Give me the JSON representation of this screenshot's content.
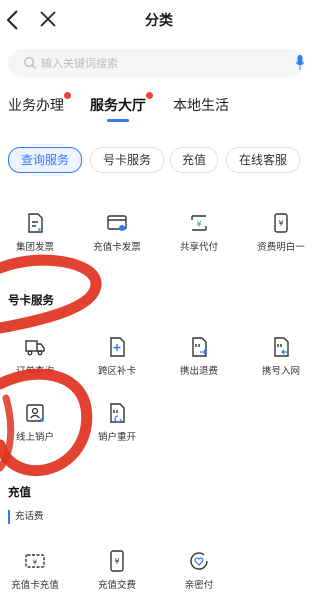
{
  "header": {
    "title": "分类",
    "back_icon": "back-arrow-icon",
    "close_icon": "close-icon"
  },
  "search": {
    "placeholder": "输入关键词搜索"
  },
  "tabs": [
    {
      "label": "业务办理",
      "badge": true,
      "active": false
    },
    {
      "label": "服务大厅",
      "badge": true,
      "active": true
    },
    {
      "label": "本地生活",
      "badge": false,
      "active": false
    }
  ],
  "chips": [
    {
      "label": "查询服务",
      "active": true
    },
    {
      "label": "号卡服务",
      "active": false
    },
    {
      "label": "充值",
      "active": false
    },
    {
      "label": "在线客服",
      "active": false
    }
  ],
  "query_items": [
    {
      "label": "集团发票",
      "icon": "invoice-icon"
    },
    {
      "label": "充值卡发票",
      "icon": "card-invoice-icon"
    },
    {
      "label": "共享代付",
      "icon": "shared-payment-icon"
    },
    {
      "label": "资费明白一",
      "icon": "tariff-icon"
    }
  ],
  "card_section": {
    "title": "号卡服务",
    "items": [
      {
        "label": "订单查询",
        "icon": "truck-icon"
      },
      {
        "label": "跨区补卡",
        "icon": "add-card-icon"
      },
      {
        "label": "携出退费",
        "icon": "port-out-icon"
      },
      {
        "label": "携号入网",
        "icon": "port-in-icon"
      },
      {
        "label": "线上销户",
        "icon": "id-card-icon"
      },
      {
        "label": "销户重开",
        "icon": "reopen-icon"
      }
    ]
  },
  "recharge_section": {
    "title": "充值",
    "subtitle": "充话费",
    "items": [
      {
        "label": "充值卡充值",
        "icon": "recharge-card-icon"
      },
      {
        "label": "充值交费",
        "icon": "yuan-phone-icon"
      },
      {
        "label": "亲密付",
        "icon": "heart-pay-icon"
      }
    ]
  },
  "colors": {
    "accent": "#2e7cf6",
    "badge": "#e8443a",
    "scribble": "#e0321e"
  }
}
